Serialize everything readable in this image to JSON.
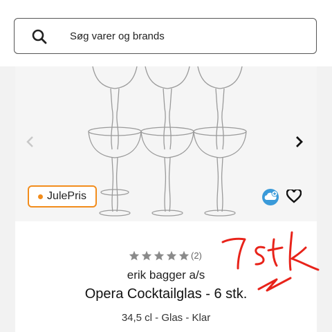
{
  "search": {
    "placeholder": "Søg varer og brands"
  },
  "product": {
    "badge": "JulePris",
    "rating_stars": 5,
    "rating_count": "(2)",
    "brand": "erik bagger a/s",
    "title": "Opera Cocktailglas - 6 stk.",
    "subtitle": "34,5 cl - Glas - Klar"
  },
  "annotation": {
    "handwritten_note": "7stk"
  },
  "colors": {
    "badge_border": "#f28c1b",
    "annotation_red": "#e8231a",
    "cloud_badge": "#3a9ad9"
  },
  "icons": [
    "search-icon",
    "chevron-left-icon",
    "chevron-right-icon",
    "cloud-plus-icon",
    "heart-icon",
    "star-icon"
  ]
}
